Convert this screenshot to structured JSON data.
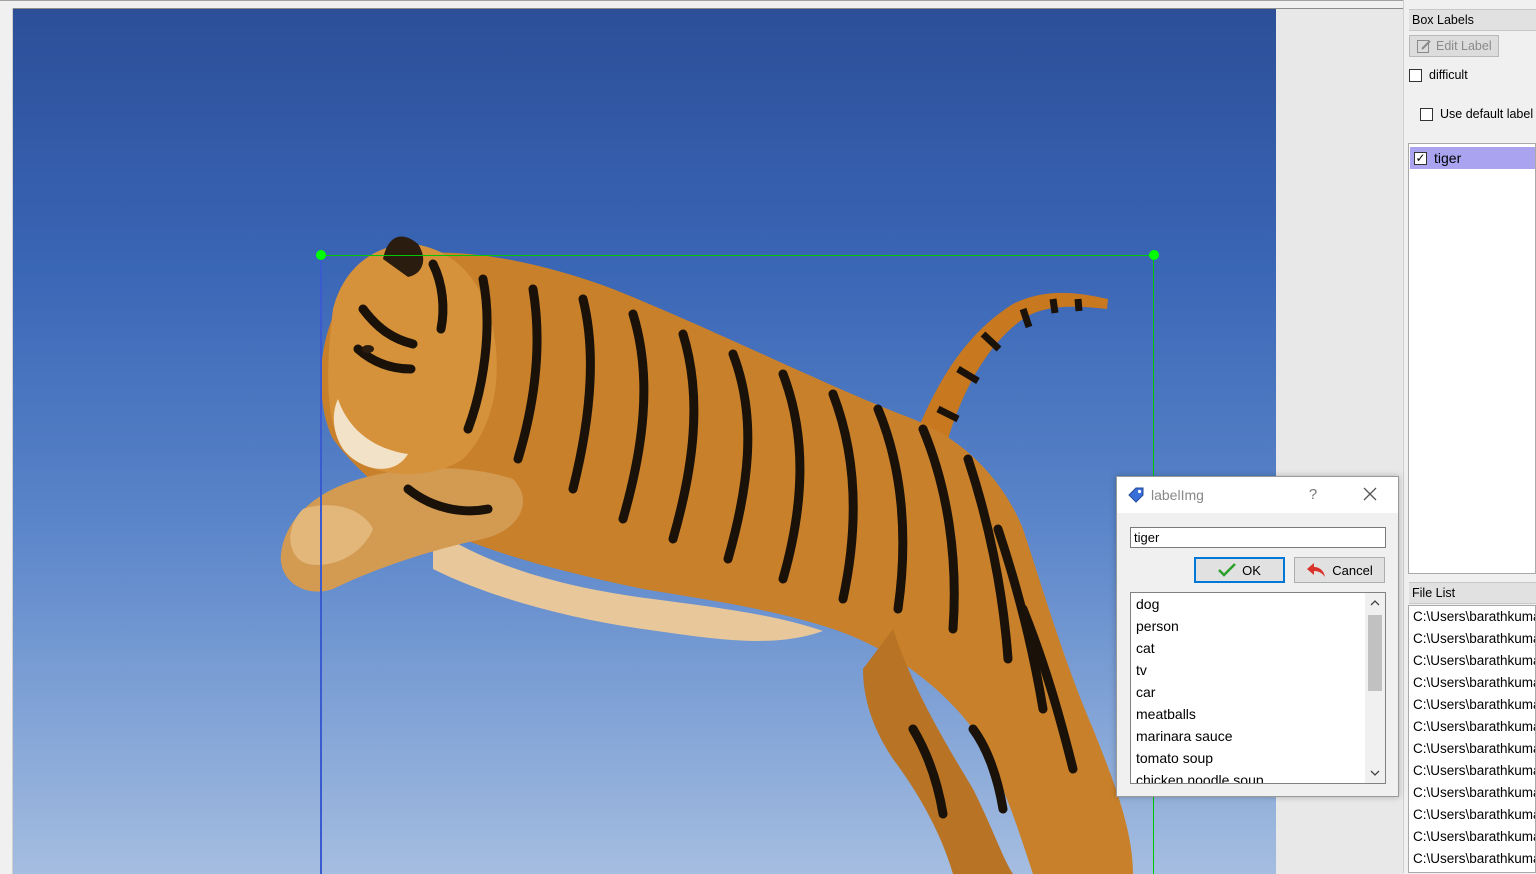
{
  "canvas": {
    "image_description_name": "tiger-photo",
    "box_color": "#00c800",
    "handle_color": "#00ff00"
  },
  "dock": {
    "box_labels_title": "Box Labels",
    "edit_label": "Edit Label",
    "difficult_label": "difficult",
    "use_default_label": "Use default label",
    "labels": [
      {
        "text": "tiger",
        "checked": true
      }
    ],
    "file_list_title": "File List",
    "files": [
      "C:\\Users\\barathkumar",
      "C:\\Users\\barathkumar",
      "C:\\Users\\barathkumar",
      "C:\\Users\\barathkumar",
      "C:\\Users\\barathkumar",
      "C:\\Users\\barathkumar",
      "C:\\Users\\barathkumar",
      "C:\\Users\\barathkumar",
      "C:\\Users\\barathkumar",
      "C:\\Users\\barathkumar",
      "C:\\Users\\barathkumar",
      "C:\\Users\\barathkumar"
    ]
  },
  "dialog": {
    "title": "labelImg",
    "help": "?",
    "input_value": "tiger",
    "ok_label": "OK",
    "cancel_label": "Cancel",
    "suggestions": [
      "dog",
      "person",
      "cat",
      "tv",
      "car",
      "meatballs",
      "marinara sauce",
      "tomato soup",
      "chicken noodle soup"
    ]
  }
}
